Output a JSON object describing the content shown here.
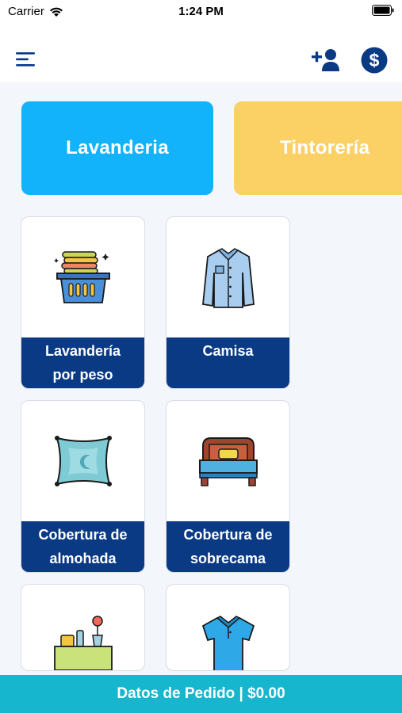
{
  "status_bar": {
    "carrier": "Carrier",
    "time": "1:24 PM"
  },
  "header": {
    "menu_icon": "hamburger-menu-icon",
    "add_user_icon": "add-user-icon",
    "currency_icon": "dollar-circle-icon"
  },
  "categories": [
    {
      "label": "Lavanderia",
      "color": "#12b3fb"
    },
    {
      "label": "Tintorería",
      "color": "#fbd064"
    }
  ],
  "services": [
    {
      "line1": "Lavandería",
      "line2": "por peso",
      "icon": "laundry-basket-icon"
    },
    {
      "line1": "Camisa",
      "line2": "",
      "icon": "shirt-icon"
    },
    {
      "line1": "Cobertura de",
      "line2": "almohada",
      "icon": "pillow-icon"
    },
    {
      "line1": "Cobertura de",
      "line2": "sobrecama",
      "icon": "bed-icon"
    },
    {
      "line1": "",
      "line2": "",
      "icon": "tablecloth-icon"
    },
    {
      "line1": "",
      "line2": "",
      "icon": "polo-shirt-icon"
    }
  ],
  "footer": {
    "label": "Datos de Pedido | $0.00"
  },
  "colors": {
    "label_bg": "#0b3a85",
    "footer_bg": "#16b6cf",
    "accent_dark": "#0b3a85"
  }
}
